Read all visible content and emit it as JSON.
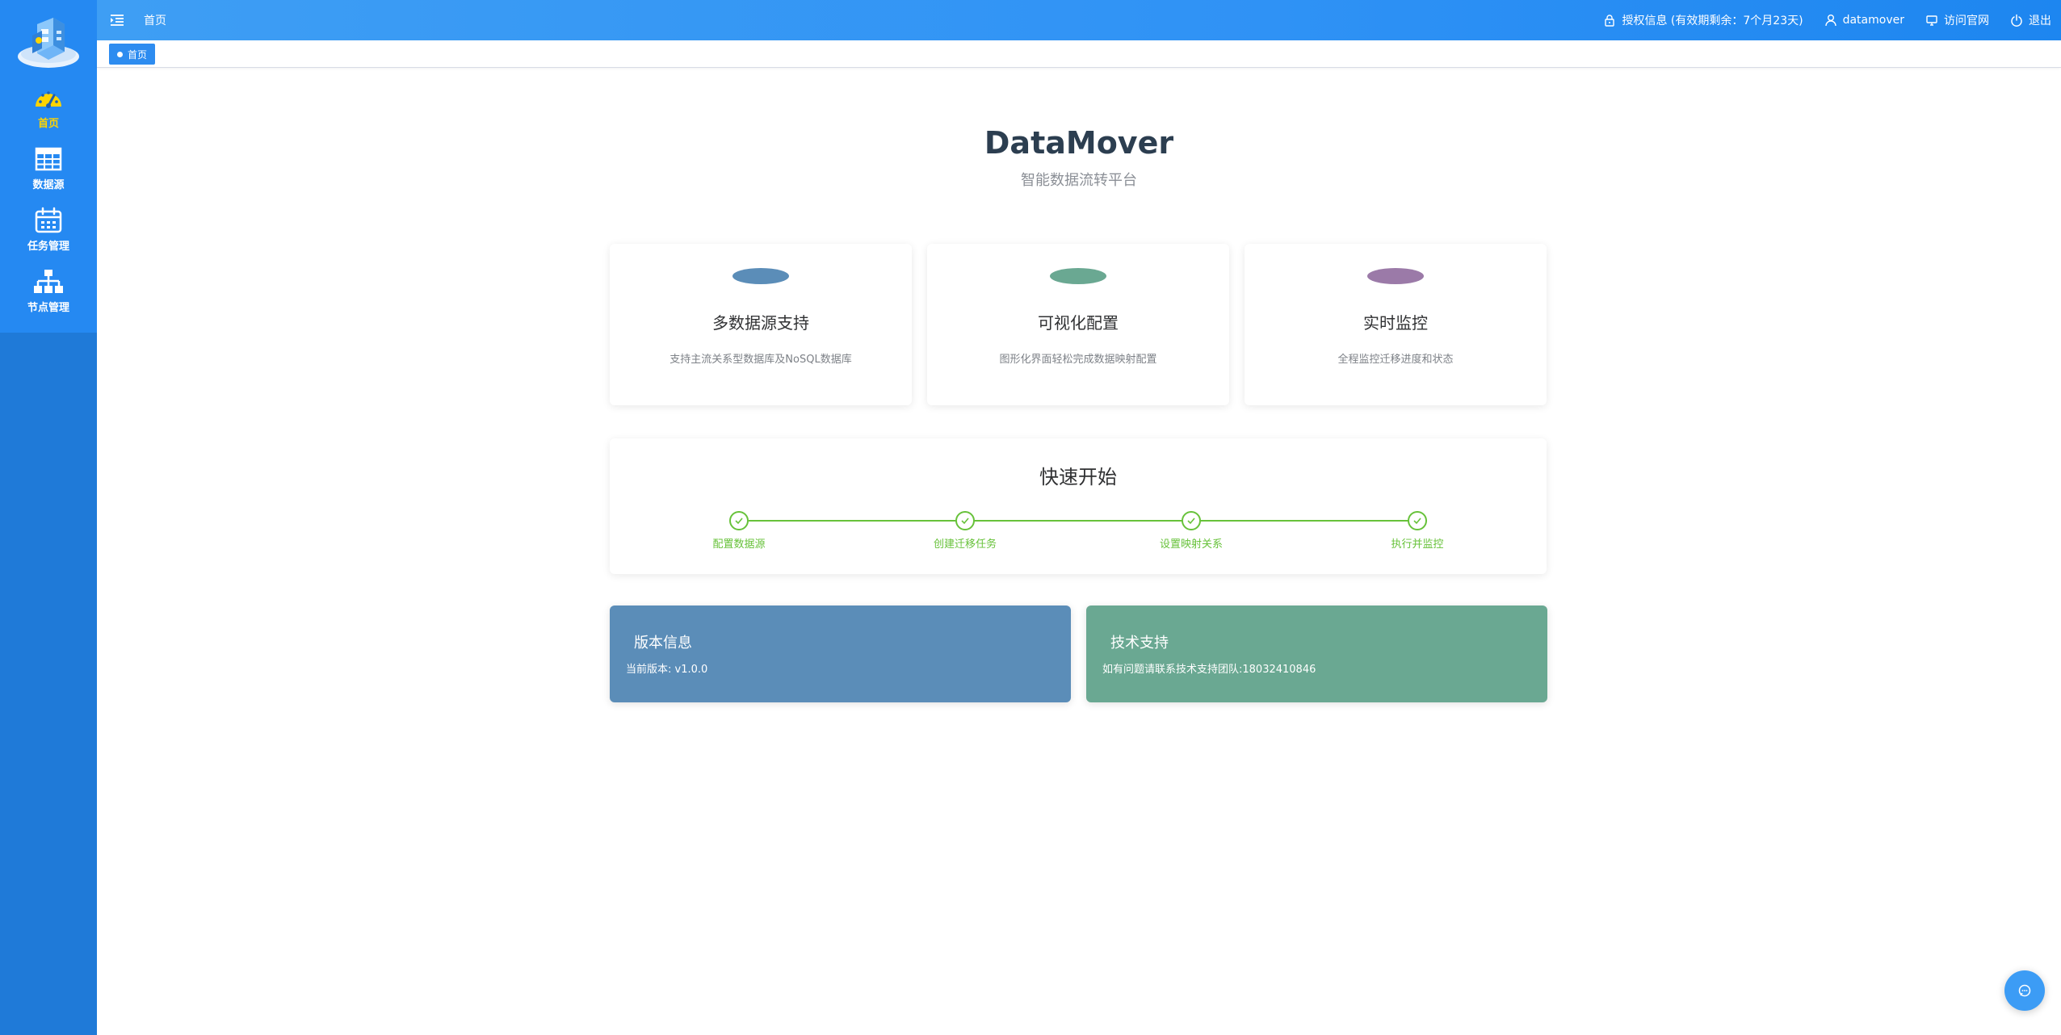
{
  "sidebar": {
    "items": [
      {
        "label": "首页",
        "icon": "dashboard-gauge-icon",
        "active": true
      },
      {
        "label": "数据源",
        "icon": "table-grid-icon",
        "active": false
      },
      {
        "label": "任务管理",
        "icon": "calendar-icon",
        "active": false
      },
      {
        "label": "节点管理",
        "icon": "org-tree-icon",
        "active": false
      }
    ]
  },
  "header": {
    "title": "首页",
    "license": "授权信息 (有效期剩余：7个月23天)",
    "user": "datamover",
    "website": "访问官网",
    "logout": "退出"
  },
  "tags": [
    {
      "label": "首页",
      "active": true
    }
  ],
  "main": {
    "title": "DataMover",
    "subtitle": "智能数据流转平台",
    "features": [
      {
        "title": "多数据源支持",
        "desc": "支持主流关系型数据库及NoSQL数据库",
        "color": "#5b8db8"
      },
      {
        "title": "可视化配置",
        "desc": "图形化界面轻松完成数据映射配置",
        "color": "#6aa892"
      },
      {
        "title": "实时监控",
        "desc": "全程监控迁移进度和状态",
        "color": "#9b7aa8"
      }
    ],
    "quick_start": {
      "title": "快速开始",
      "steps": [
        "配置数据源",
        "创建迁移任务",
        "设置映射关系",
        "执行并监控"
      ]
    },
    "version": {
      "title": "版本信息",
      "text": "当前版本: v1.0.0",
      "color": "#5b8db8"
    },
    "support": {
      "title": "技术支持",
      "text": "如有问题请联系技术支持团队:18032410846",
      "color": "#6aa892"
    }
  },
  "colors": {
    "accent": "#2d8cf0",
    "success": "#67c23a",
    "sidebar": "#1f7ad8"
  }
}
